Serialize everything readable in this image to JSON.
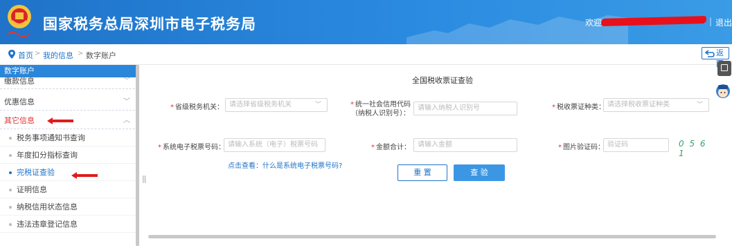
{
  "header": {
    "site_title": "国家税务总局深圳市电子税务局",
    "welcome": "欢迎",
    "separator": "|",
    "logout": "退出",
    "bg_color": "#2a86da"
  },
  "breadcrumb": {
    "items": [
      "首页",
      "我的信息",
      "数字账户"
    ],
    "sep": ">",
    "back_label": "返回"
  },
  "sidebar": {
    "header": "数字账户",
    "items": [
      {
        "label": "缴款信息",
        "icon": "chevron-down-icon"
      },
      {
        "label": "优惠信息",
        "icon": "chevron-down-icon"
      },
      {
        "label": "其它信息",
        "icon": "chevron-up-icon"
      }
    ],
    "subitems": [
      "税务事项通知书查询",
      "年度扣分指标查询",
      "完税证查验",
      "证明信息",
      "纳税信用状态信息",
      "违法违章登记信息"
    ],
    "active_subitem": "完税证查验",
    "collapse_handle": "||"
  },
  "form": {
    "title": "全国税收票证查验",
    "authority_label": "省级税务机关：",
    "authority_placeholder": "请选择省级税务机关",
    "credit_code_label_1": "统一社会信用代码",
    "credit_code_label_2": "（纳税人识别号）：",
    "credit_code_placeholder": "请输入纳税人识别号",
    "voucher_type_label": "税收票证种类：",
    "voucher_type_placeholder": "请选择税收票证种类",
    "voucher_no_label": "系统电子税票号码：",
    "voucher_no_placeholder": "请输入系统（电子）税票号码",
    "amount_label": "金额合计：",
    "amount_placeholder": "请输入金额",
    "captcha_label": "图片验证码：",
    "captcha_placeholder": "验证码",
    "captcha_text": "0 5 6 1",
    "required_mark": "*",
    "help_link": "点击查看：什么是系统电子税票号码?",
    "reset_label": "重 置",
    "check_label": "查 验",
    "accent": "#3b97e3",
    "required_color": "#e23030"
  }
}
